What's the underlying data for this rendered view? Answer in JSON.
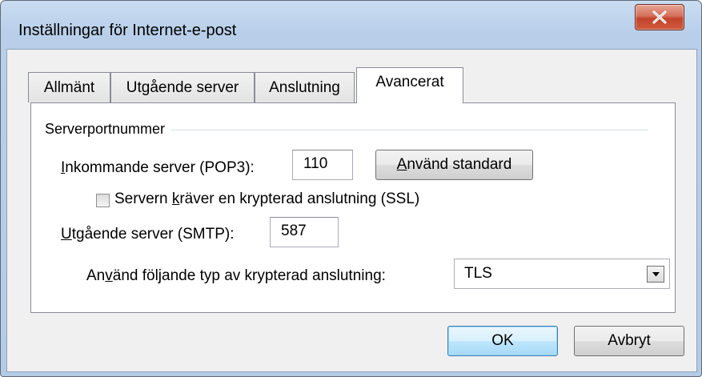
{
  "window": {
    "title": "Inställningar för Internet-e-post",
    "close_glyph": "X"
  },
  "tabs": [
    {
      "label": "Allmänt",
      "active": false
    },
    {
      "label": "Utgående server",
      "active": false
    },
    {
      "label": "Anslutning",
      "active": false
    },
    {
      "label": "Avancerat",
      "active": true
    }
  ],
  "section": {
    "title": "Serverportnummer"
  },
  "incoming": {
    "label": "Inkommande server (POP3):",
    "value": "110",
    "use_default_button": "Använd standard"
  },
  "ssl": {
    "label": "Servern kräver en krypterad anslutning (SSL)",
    "checked": false
  },
  "outgoing": {
    "label": "Utgående server (SMTP):",
    "value": "587"
  },
  "encryption": {
    "label": "Använd följande typ av krypterad anslutning:",
    "selected": "TLS"
  },
  "footer": {
    "ok_label": "OK",
    "cancel_label": "Avbryt"
  },
  "icons": {
    "close": "close-icon",
    "dropdown": "chevron-down-icon"
  },
  "colors": {
    "frame": "#b9cfe9",
    "client_bg": "#f0f0f0",
    "close_button": "#c2442c",
    "default_button_border": "#3c7fb1"
  }
}
